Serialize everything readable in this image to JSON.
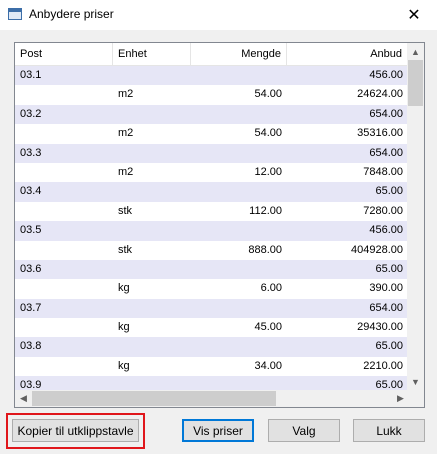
{
  "window": {
    "title": "Anbydere priser",
    "close_glyph": "✕"
  },
  "table": {
    "columns": [
      "Post",
      "Enhet",
      "Mengde",
      "Anbud"
    ],
    "rows": [
      {
        "post": "03.1",
        "enhet": "",
        "mengde": "",
        "anbud": "456.00"
      },
      {
        "post": "",
        "enhet": "m2",
        "mengde": "54.00",
        "anbud": "24624.00"
      },
      {
        "post": "03.2",
        "enhet": "",
        "mengde": "",
        "anbud": "654.00"
      },
      {
        "post": "",
        "enhet": "m2",
        "mengde": "54.00",
        "anbud": "35316.00"
      },
      {
        "post": "03.3",
        "enhet": "",
        "mengde": "",
        "anbud": "654.00"
      },
      {
        "post": "",
        "enhet": "m2",
        "mengde": "12.00",
        "anbud": "7848.00"
      },
      {
        "post": "03.4",
        "enhet": "",
        "mengde": "",
        "anbud": "65.00"
      },
      {
        "post": "",
        "enhet": "stk",
        "mengde": "112.00",
        "anbud": "7280.00"
      },
      {
        "post": "03.5",
        "enhet": "",
        "mengde": "",
        "anbud": "456.00"
      },
      {
        "post": "",
        "enhet": "stk",
        "mengde": "888.00",
        "anbud": "404928.00"
      },
      {
        "post": "03.6",
        "enhet": "",
        "mengde": "",
        "anbud": "65.00"
      },
      {
        "post": "",
        "enhet": "kg",
        "mengde": "6.00",
        "anbud": "390.00"
      },
      {
        "post": "03.7",
        "enhet": "",
        "mengde": "",
        "anbud": "654.00"
      },
      {
        "post": "",
        "enhet": "kg",
        "mengde": "45.00",
        "anbud": "29430.00"
      },
      {
        "post": "03.8",
        "enhet": "",
        "mengde": "",
        "anbud": "65.00"
      },
      {
        "post": "",
        "enhet": "kg",
        "mengde": "34.00",
        "anbud": "2210.00"
      },
      {
        "post": "03.9",
        "enhet": "",
        "mengde": "",
        "anbud": "65.00"
      }
    ]
  },
  "scrollbars": {
    "up_glyph": "▲",
    "down_glyph": "▼",
    "left_glyph": "◀",
    "right_glyph": "▶"
  },
  "buttons": {
    "copy": "Kopier til utklippstavle",
    "show_prices": "Vis priser",
    "options": "Valg",
    "close": "Lukk"
  },
  "colors": {
    "alt_row": "#e6e6f6",
    "highlight": "#e0161b",
    "default_button_border": "#0078d7"
  }
}
